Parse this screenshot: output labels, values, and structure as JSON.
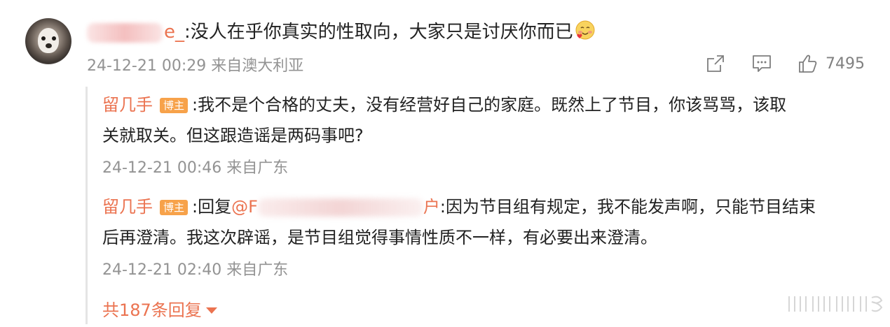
{
  "comment": {
    "author_visible_suffix": "e_",
    "text": ":没人在乎你真实的性取向，大家只是讨厌你而已",
    "emoji": "smile-heart-emoji",
    "meta": "24-12-21 00:29 来自澳大利亚",
    "like_count": "7495"
  },
  "replies": [
    {
      "author": "留几手",
      "badge": "博主",
      "line1": ":我不是个合格的丈夫，没有经营好自己的家庭。既然上了节目，你该骂骂，该取",
      "line2": "关就取关。但这跟造谣是两码事吧?",
      "meta": "24-12-21 00:46 来自广东"
    },
    {
      "author": "留几手",
      "badge": "博主",
      "reply_prefix": ":回复",
      "mention_start": "@F",
      "mention_end": "户",
      "line1_rest": ":因为节目组有规定，我不能发声啊，只能节目结束",
      "line2": "后再澄清。我这次辟谣，是节目组觉得事情性质不一样，有必要出来澄清。",
      "meta": "24-12-21 02:40 来自广东"
    }
  ],
  "more_replies_label": "共187条回复",
  "colors": {
    "accent": "#eb7350",
    "badge": "#f7a24a",
    "meta": "#939393"
  },
  "icons": [
    "share-icon",
    "comment-icon",
    "like-icon",
    "caret-down-icon"
  ]
}
